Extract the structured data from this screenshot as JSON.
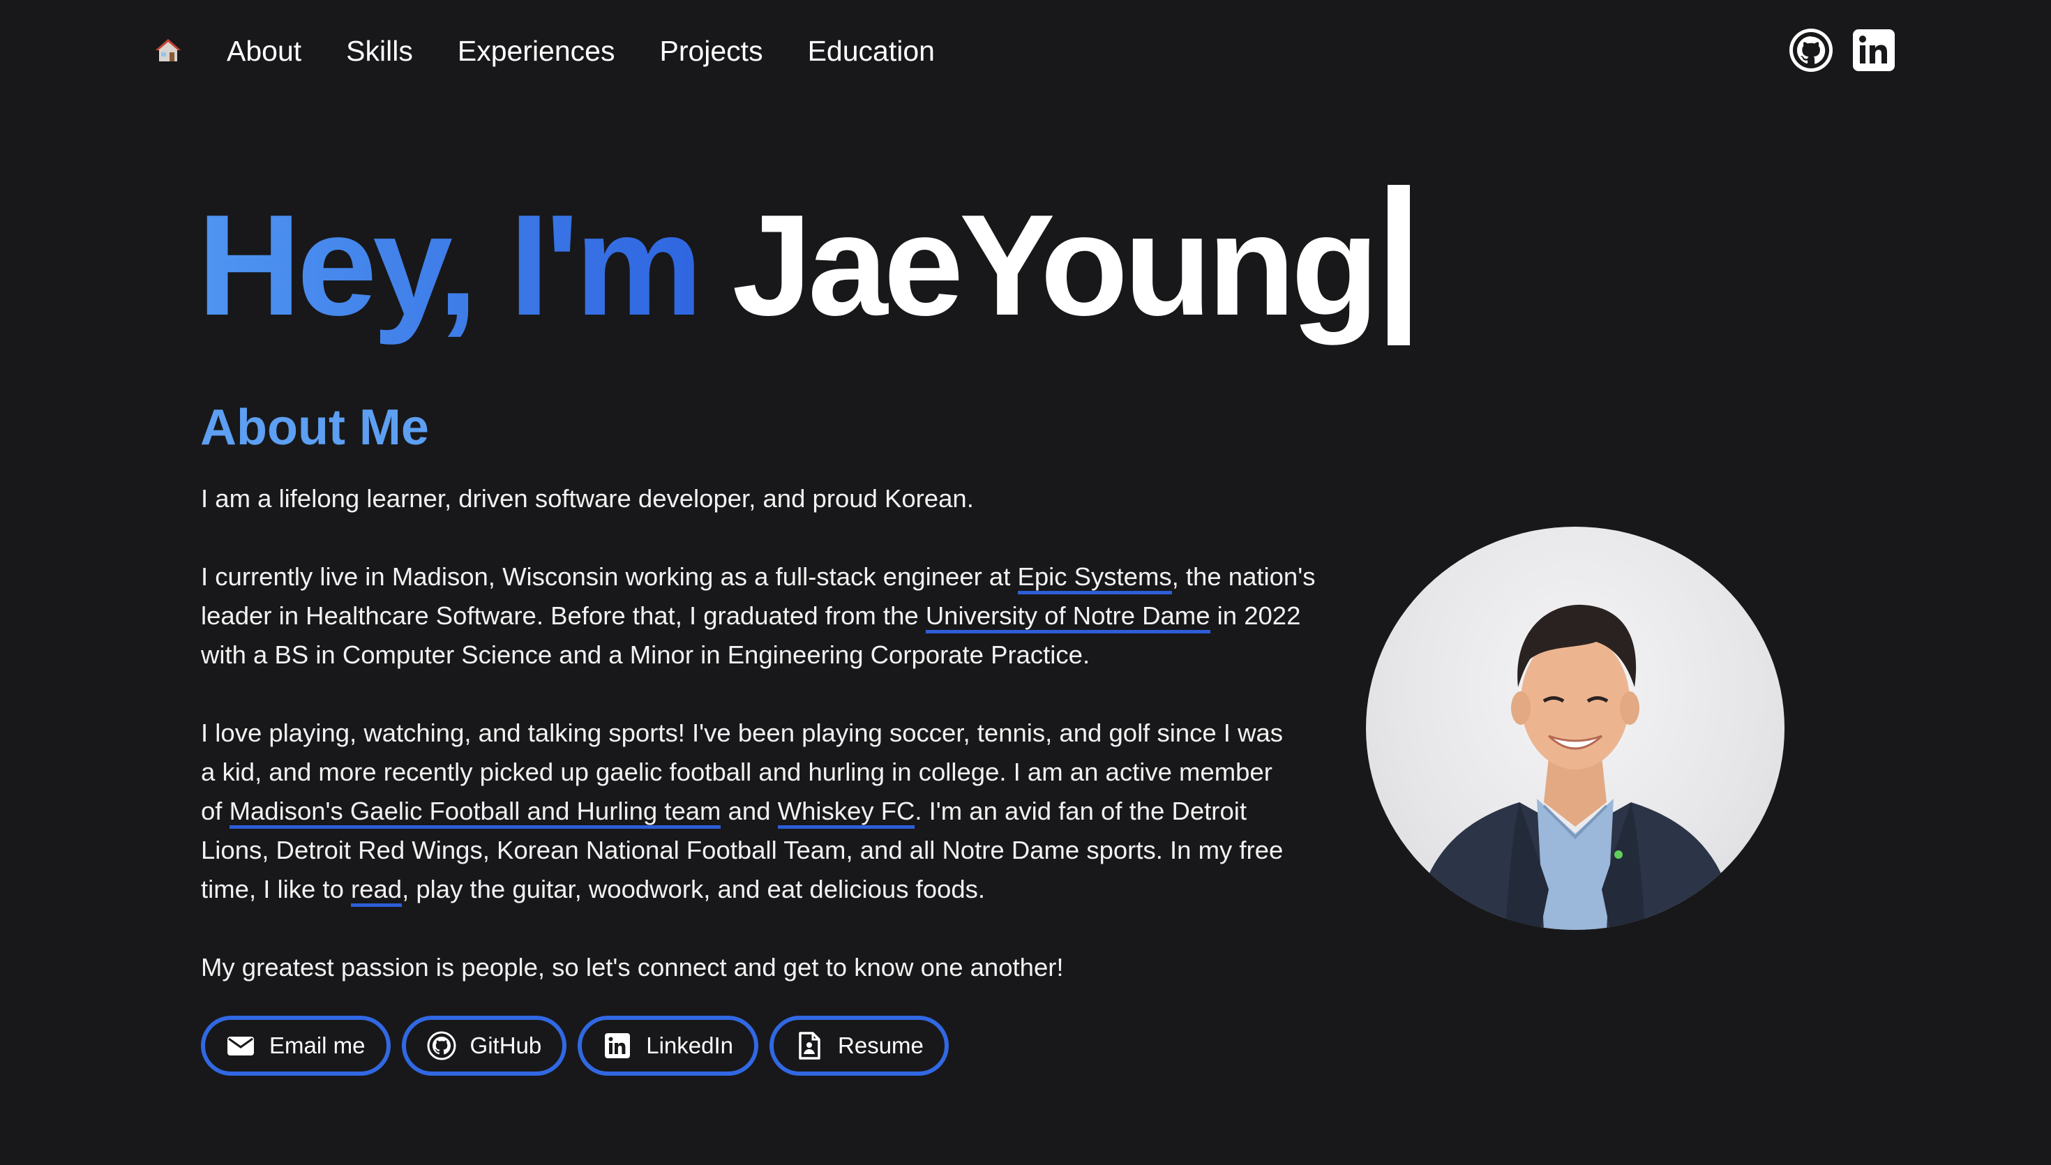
{
  "nav": {
    "home_icon": "house-emoji",
    "links": [
      {
        "label": "About"
      },
      {
        "label": "Skills"
      },
      {
        "label": "Experiences"
      },
      {
        "label": "Projects"
      },
      {
        "label": "Education"
      }
    ],
    "social": [
      {
        "icon": "github-icon"
      },
      {
        "icon": "linkedin-icon"
      }
    ]
  },
  "hero": {
    "greeting": "Hey, I'm",
    "name": "JaeYoung"
  },
  "about": {
    "title": "About Me",
    "p1": "I am a lifelong learner, driven software developer, and proud Korean.",
    "p2": {
      "t1": "I currently live in Madison, Wisconsin working as a full-stack engineer at ",
      "link1": "Epic Systems",
      "t2": ", the nation's leader in Healthcare Software. Before that, I graduated from the ",
      "link2": "University of Notre Dame",
      "t3": " in 2022 with a BS in Computer Science and a Minor in Engineering Corporate Practice."
    },
    "p3": {
      "t1": "I love playing, watching, and talking sports! I've been playing soccer, tennis, and golf since I was a kid, and more recently picked up gaelic football and hurling in college. I am an active member of ",
      "link1": "Madison's Gaelic Football and Hurling team",
      "t2": " and ",
      "link2": "Whiskey FC",
      "t3": ". I'm an avid fan of the Detroit Lions, Detroit Red Wings, Korean National Football Team, and all Notre Dame sports. In my free time, I like to ",
      "link3": "read",
      "t4": ", play the guitar, woodwork, and eat delicious foods."
    },
    "p4": "My greatest passion is people, so let's connect and get to know one another!"
  },
  "buttons": [
    {
      "label": "Email me",
      "icon": "envelope-icon"
    },
    {
      "label": "GitHub",
      "icon": "github-icon"
    },
    {
      "label": "LinkedIn",
      "icon": "linkedin-icon"
    },
    {
      "label": "Resume",
      "icon": "resume-file-icon"
    }
  ],
  "colors": {
    "background": "#18181a",
    "accent_blue": "#5d9ff2",
    "button_border": "#3168e3",
    "link_underline": "#2e5ed8"
  }
}
